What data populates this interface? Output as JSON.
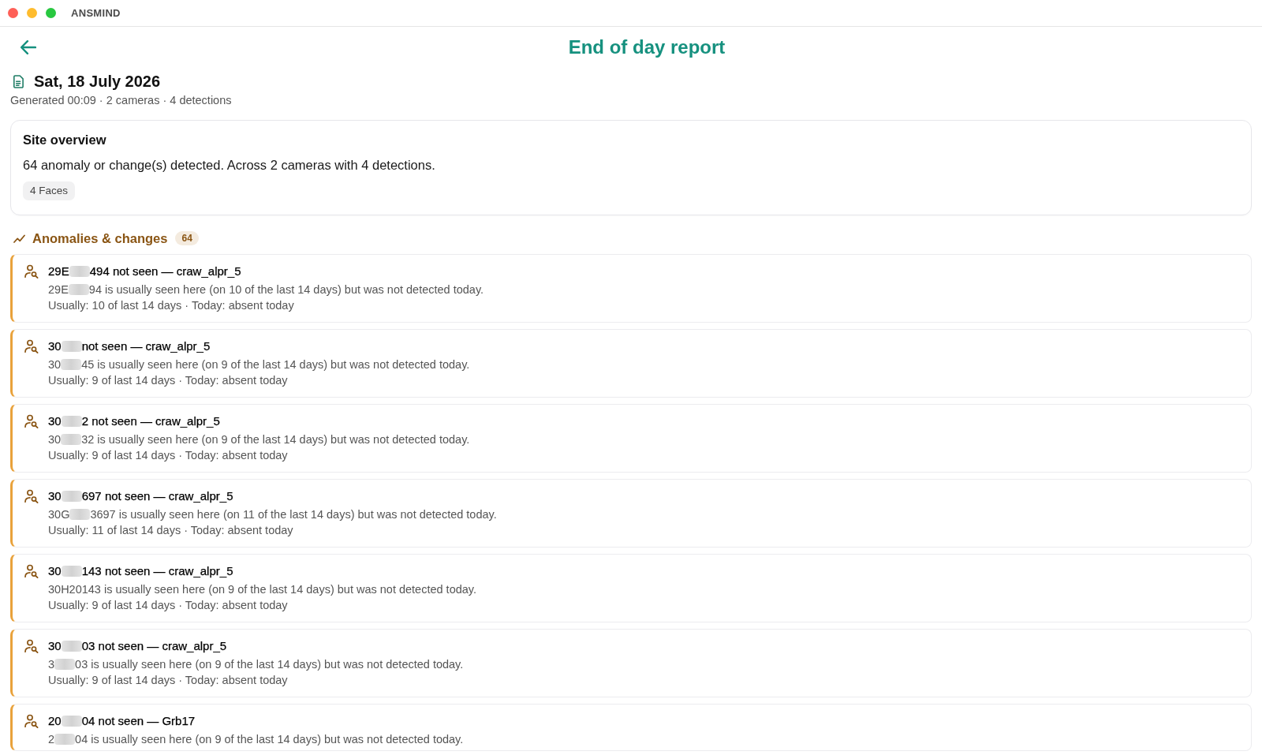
{
  "window": {
    "title": "ANSMIND"
  },
  "header": {
    "title": "End of day report"
  },
  "report": {
    "date": "Sat, 18 July 2026",
    "summary": "Generated 00:09 · 2 cameras · 4 detections"
  },
  "site_overview": {
    "title": "Site overview",
    "text": "64 anomaly or change(s) detected. Across 2 cameras with 4 detections.",
    "tags": [
      "4 Faces"
    ]
  },
  "anomalies": {
    "title": "Anomalies & changes",
    "count": "64",
    "items": [
      {
        "title_parts": [
          "29E",
          "494 not seen — craw_alpr_5"
        ],
        "description_parts": [
          "29E",
          "94 is usually seen here (on 10 of the last 14 days) but was not detected today."
        ],
        "meta": "Usually: 10 of last 14 days · Today: absent today"
      },
      {
        "title_parts": [
          "30",
          "not seen — craw_alpr_5"
        ],
        "description_parts": [
          "30",
          "45 is usually seen here (on 9 of the last 14 days) but was not detected today."
        ],
        "meta": "Usually: 9 of last 14 days · Today: absent today"
      },
      {
        "title_parts": [
          "30",
          "2 not seen — craw_alpr_5"
        ],
        "description_parts": [
          "30",
          "32 is usually seen here (on 9 of the last 14 days) but was not detected today."
        ],
        "meta": "Usually: 9 of last 14 days · Today: absent today"
      },
      {
        "title_parts": [
          "30",
          "697 not seen — craw_alpr_5"
        ],
        "description_parts": [
          "30G",
          "3697 is usually seen here (on 11 of the last 14 days) but was not detected today."
        ],
        "meta": "Usually: 11 of last 14 days · Today: absent today"
      },
      {
        "title_parts": [
          "30",
          "143 not seen — craw_alpr_5"
        ],
        "description_parts": [
          "30H20143 is usually seen here (on 9 of the last 14 days) but was not detected today."
        ],
        "meta": "Usually: 9 of last 14 days · Today: absent today"
      },
      {
        "title_parts": [
          "30",
          "03 not seen — craw_alpr_5"
        ],
        "description_parts": [
          "3",
          "03 is usually seen here (on 9 of the last 14 days) but was not detected today."
        ],
        "meta": "Usually: 9 of last 14 days · Today: absent today"
      },
      {
        "title_parts": [
          "20",
          "04 not seen — Grb17"
        ],
        "description_parts": [
          "2",
          "04 is usually seen here (on 9 of the last 14 days) but was not detected today."
        ]
      }
    ]
  }
}
